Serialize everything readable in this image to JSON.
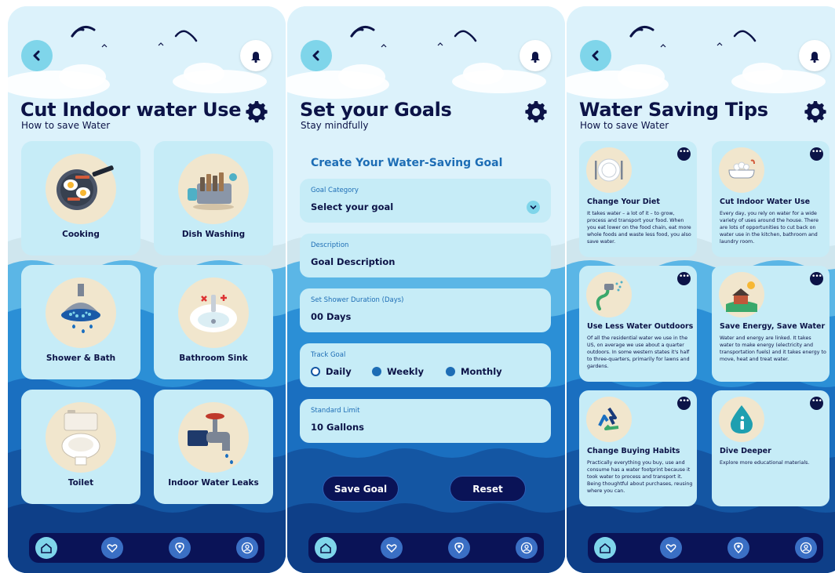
{
  "colors": {
    "navy": "#0c1347",
    "accent": "#7fd5ea",
    "card": "#c6ecf7",
    "sky": "#dcf2fb",
    "blue": "#1d6db5"
  },
  "screen1": {
    "title": "Cut Indoor water Use",
    "subtitle": "How to save Water",
    "categories": [
      {
        "label": "Cooking",
        "icon": "frying-pan-icon"
      },
      {
        "label": "Dish Washing",
        "icon": "dishes-icon"
      },
      {
        "label": "Shower & Bath",
        "icon": "shower-head-icon"
      },
      {
        "label": "Bathroom Sink",
        "icon": "sink-icon"
      },
      {
        "label": "Toilet",
        "icon": "toilet-icon"
      },
      {
        "label": "Indoor Water Leaks",
        "icon": "leaking-faucet-icon"
      }
    ]
  },
  "screen2": {
    "title": "Set your Goals",
    "subtitle": "Stay mindfully",
    "form_title": "Create Your Water-Saving Goal",
    "fields": [
      {
        "label": "Goal Category",
        "value": "Select your goal"
      },
      {
        "label": "Description",
        "value": "Goal Description"
      },
      {
        "label": "Set Shower Duration (Days)",
        "value": "00 Days"
      },
      {
        "label": "Track Goal",
        "options": [
          "Daily",
          "Weekly",
          "Monthly"
        ]
      },
      {
        "label": "Standard Limit",
        "value": "10 Gallons"
      }
    ],
    "buttons": {
      "save": "Save Goal",
      "reset": "Reset"
    }
  },
  "screen3": {
    "title": "Water Saving Tips",
    "subtitle": "How to save Water",
    "tips": [
      {
        "title": "Change Your Diet",
        "icon": "plate-cutlery-icon",
        "desc": "It takes water – a lot of it – to grow, process and transport your food. When you eat lower on the food chain, eat more whole foods and waste less food, you also save water."
      },
      {
        "title": "Cut Indoor Water Use",
        "icon": "bathtub-icon",
        "desc": "Every day, you rely on water for a wide variety of uses around the house. There are lots of opportunities to cut back on water use in the kitchen, bathroom and laundry room."
      },
      {
        "title": "Use Less Water Outdoors",
        "icon": "garden-hose-icon",
        "desc": "Of all the residential water we use in the US, on average we use about a quarter outdoors. In some western states it's half to three-quarters, primarily for lawns and gardens."
      },
      {
        "title": "Save Energy, Save Water",
        "icon": "house-sun-icon",
        "desc": "Water and energy are linked. It takes water to make energy (electricity and transportation fuels) and it takes energy to move, heat and treat water."
      },
      {
        "title": "Change Buying Habits",
        "icon": "recycle-icon",
        "desc": "Practically everything you buy, use and consume has a water footprint because it took water to process and transport it. Being thoughtful about purchases, reusing where you can."
      },
      {
        "title": "Dive Deeper",
        "icon": "info-drop-icon",
        "desc": "Explore more educational materials."
      }
    ]
  },
  "nav": [
    "home-icon",
    "heart-hand-icon",
    "location-pin-icon",
    "profile-icon"
  ]
}
